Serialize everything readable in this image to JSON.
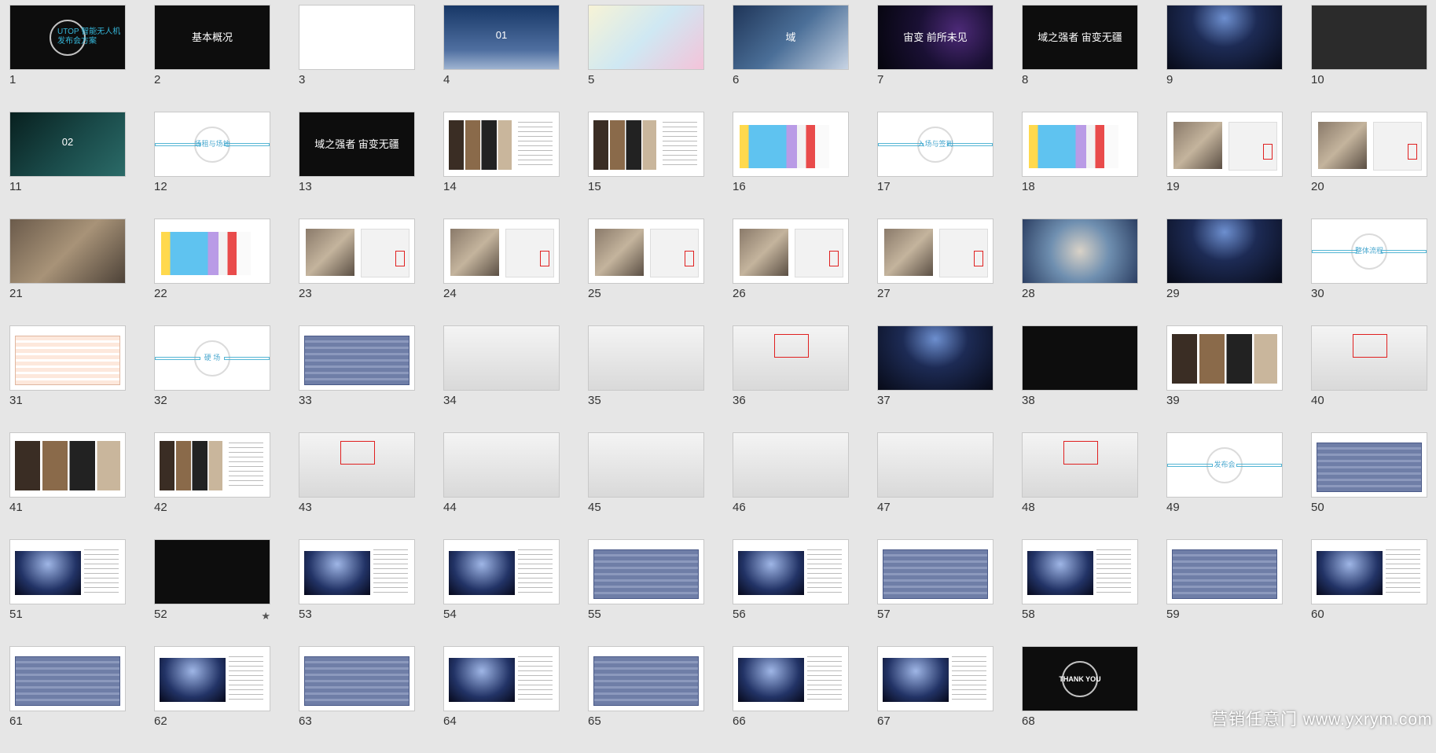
{
  "slides": [
    {
      "n": "1",
      "style": "dark",
      "text": "UTOP 智能无人机 发布会方案"
    },
    {
      "n": "2",
      "style": "dark",
      "text": "基本概况"
    },
    {
      "n": "3",
      "style": "white",
      "text": ""
    },
    {
      "n": "4",
      "style": "sky",
      "text": "01"
    },
    {
      "n": "5",
      "style": "colorful",
      "text": ""
    },
    {
      "n": "6",
      "style": "world",
      "text": "域"
    },
    {
      "n": "7",
      "style": "space",
      "text": "宙变 前所未见"
    },
    {
      "n": "8",
      "style": "dark",
      "text": "域之强者 宙变无疆"
    },
    {
      "n": "9",
      "style": "stage",
      "text": ""
    },
    {
      "n": "10",
      "style": "gray",
      "text": ""
    },
    {
      "n": "11",
      "style": "teal",
      "text": "02"
    },
    {
      "n": "12",
      "style": "white-bar",
      "text": "场租与场地"
    },
    {
      "n": "13",
      "style": "dark",
      "text": "域之强者 宙变无疆"
    },
    {
      "n": "14",
      "style": "white-photo",
      "text": ""
    },
    {
      "n": "15",
      "style": "white-photo",
      "text": ""
    },
    {
      "n": "16",
      "style": "plan",
      "text": ""
    },
    {
      "n": "17",
      "style": "white-bar",
      "text": "入场与签到"
    },
    {
      "n": "18",
      "style": "plan",
      "text": ""
    },
    {
      "n": "19",
      "style": "map",
      "text": ""
    },
    {
      "n": "20",
      "style": "map",
      "text": ""
    },
    {
      "n": "21",
      "style": "photo",
      "text": ""
    },
    {
      "n": "22",
      "style": "plan",
      "text": ""
    },
    {
      "n": "23",
      "style": "map",
      "text": ""
    },
    {
      "n": "24",
      "style": "map",
      "text": ""
    },
    {
      "n": "25",
      "style": "map",
      "text": ""
    },
    {
      "n": "26",
      "style": "map",
      "text": ""
    },
    {
      "n": "27",
      "style": "map",
      "text": ""
    },
    {
      "n": "28",
      "style": "face",
      "text": ""
    },
    {
      "n": "29",
      "style": "stage",
      "text": ""
    },
    {
      "n": "30",
      "style": "white-bar",
      "text": "整体流程"
    },
    {
      "n": "31",
      "style": "table",
      "text": ""
    },
    {
      "n": "32",
      "style": "white-bar",
      "text": "硬 场"
    },
    {
      "n": "33",
      "style": "table-blue",
      "text": ""
    },
    {
      "n": "34",
      "style": "room",
      "text": ""
    },
    {
      "n": "35",
      "style": "room",
      "text": ""
    },
    {
      "n": "36",
      "style": "room-red",
      "text": ""
    },
    {
      "n": "37",
      "style": "stage",
      "text": ""
    },
    {
      "n": "38",
      "style": "dark",
      "text": ""
    },
    {
      "n": "39",
      "style": "photos",
      "text": ""
    },
    {
      "n": "40",
      "style": "room-red",
      "text": ""
    },
    {
      "n": "41",
      "style": "photos",
      "text": ""
    },
    {
      "n": "42",
      "style": "white-photo",
      "text": ""
    },
    {
      "n": "43",
      "style": "room-red",
      "text": ""
    },
    {
      "n": "44",
      "style": "room",
      "text": ""
    },
    {
      "n": "45",
      "style": "room",
      "text": ""
    },
    {
      "n": "46",
      "style": "room",
      "text": ""
    },
    {
      "n": "47",
      "style": "room",
      "text": ""
    },
    {
      "n": "48",
      "style": "room-red",
      "text": ""
    },
    {
      "n": "49",
      "style": "white-bar",
      "text": "发布会"
    },
    {
      "n": "50",
      "style": "table-blue",
      "text": ""
    },
    {
      "n": "51",
      "style": "stage-text",
      "text": ""
    },
    {
      "n": "52",
      "style": "black",
      "text": "",
      "star": "★"
    },
    {
      "n": "53",
      "style": "stage-text",
      "text": ""
    },
    {
      "n": "54",
      "style": "stage-text",
      "text": ""
    },
    {
      "n": "55",
      "style": "table-blue",
      "text": ""
    },
    {
      "n": "56",
      "style": "stage-text",
      "text": ""
    },
    {
      "n": "57",
      "style": "table-blue",
      "text": ""
    },
    {
      "n": "58",
      "style": "stage-text",
      "text": ""
    },
    {
      "n": "59",
      "style": "table-blue",
      "text": ""
    },
    {
      "n": "60",
      "style": "stage-text",
      "text": ""
    },
    {
      "n": "61",
      "style": "table-blue",
      "text": ""
    },
    {
      "n": "62",
      "style": "stage-text",
      "text": ""
    },
    {
      "n": "63",
      "style": "table-blue",
      "text": ""
    },
    {
      "n": "64",
      "style": "stage-text",
      "text": ""
    },
    {
      "n": "65",
      "style": "table-blue",
      "text": ""
    },
    {
      "n": "66",
      "style": "stage-text",
      "text": ""
    },
    {
      "n": "67",
      "style": "stage-text",
      "text": ""
    },
    {
      "n": "68",
      "style": "thanks",
      "text": "THANK YOU"
    }
  ],
  "watermark": "营销任意门 www.yxrym.com"
}
